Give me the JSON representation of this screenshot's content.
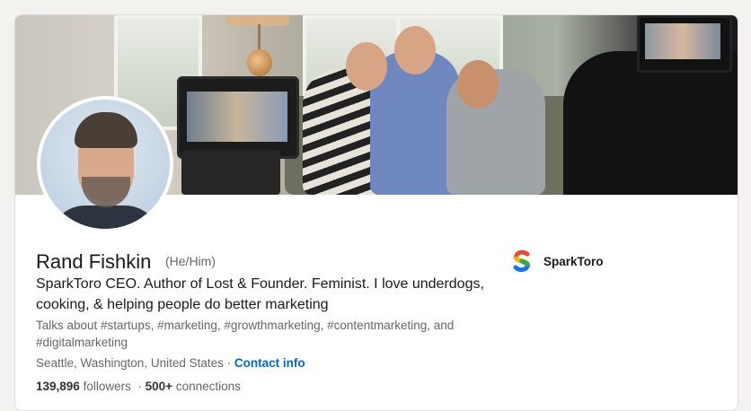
{
  "profile": {
    "name": "Rand Fishkin",
    "pronouns": "(He/Him)",
    "headline": "SparkToro CEO. Author of Lost & Founder. Feminist. I love underdogs, cooking, & helping people do better marketing",
    "talks_about": "Talks about #startups, #marketing, #growthmarketing, #contentmarketing, and #digitalmarketing",
    "location": "Seattle, Washington, United States",
    "contact_label": "Contact info",
    "followers_count": "139,896",
    "followers_label": "followers",
    "connections_count": "500+",
    "connections_label": "connections",
    "separator": "·"
  },
  "company": {
    "name": "SparkToro"
  },
  "colors": {
    "accent": "#0a66c2",
    "background": "#f3f2ef"
  },
  "icons": {
    "company_logo": "sparktoro-logo-icon"
  }
}
